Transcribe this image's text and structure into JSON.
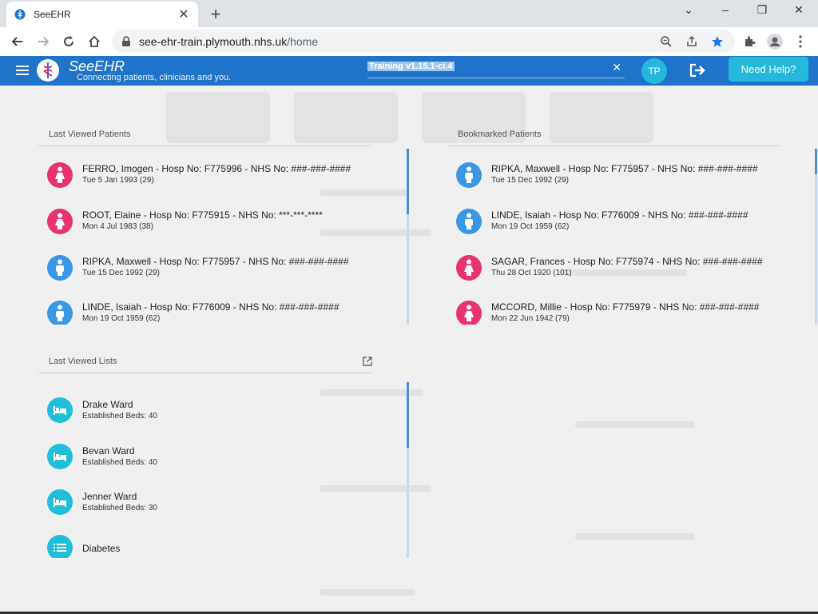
{
  "browser": {
    "tab_title": "SeeEHR",
    "url_host": "see-ehr-train.plymouth.nhs.uk",
    "url_path": "/home"
  },
  "header": {
    "brand": "SeeEHR",
    "tagline": "Connecting patients, clinicians and you.",
    "environment": "Training v1.15.1-ci.4",
    "user_initials": "TP",
    "help_label": "Need Help?"
  },
  "colors": {
    "brand_blue": "#1f73c8",
    "female": "#e8346e",
    "male": "#3a97e6",
    "list": "#1fbfd9"
  },
  "last_viewed_patients": {
    "title": "Last Viewed Patients",
    "items": [
      {
        "name": "FERRO, Imogen - Hosp No: F775996 - NHS No: ###-###-####",
        "sub": "Tue 5 Jan 1993 (29)",
        "sex": "female"
      },
      {
        "name": "ROOT, Elaine - Hosp No: F775915 - NHS No: ***-***-****",
        "sub": "Mon 4 Jul 1983 (38)",
        "sex": "female"
      },
      {
        "name": "RIPKA, Maxwell - Hosp No: F775957 - NHS No: ###-###-####",
        "sub": "Tue 15 Dec 1992 (29)",
        "sex": "male"
      },
      {
        "name": "LINDE, Isaiah - Hosp No: F776009 - NHS No: ###-###-####",
        "sub": "Mon 19 Oct 1959 (62)",
        "sex": "male"
      }
    ]
  },
  "bookmarked_patients": {
    "title": "Bookmarked Patients",
    "items": [
      {
        "name": "RIPKA, Maxwell - Hosp No: F775957 - NHS No: ###-###-####",
        "sub": "Tue 15 Dec 1992 (29)",
        "sex": "male"
      },
      {
        "name": "LINDE, Isaiah - Hosp No: F776009 - NHS No: ###-###-####",
        "sub": "Mon 19 Oct 1959 (62)",
        "sex": "male"
      },
      {
        "name": "SAGAR, Frances - Hosp No: F775974 - NHS No: ###-###-####",
        "sub": "Thu 28 Oct 1920 (101)",
        "sex": "female"
      },
      {
        "name": "MCCORD, Millie - Hosp No: F775979 - NHS No: ###-###-####",
        "sub": "Mon 22 Jun 1942 (79)",
        "sex": "female"
      }
    ]
  },
  "last_viewed_lists": {
    "title": "Last Viewed Lists",
    "items": [
      {
        "name": "Drake Ward",
        "sub": "Established Beds: 40",
        "icon": "bed-icon"
      },
      {
        "name": "Bevan Ward",
        "sub": "Established Beds: 40",
        "icon": "bed-icon"
      },
      {
        "name": "Jenner Ward",
        "sub": "Established Beds: 30",
        "icon": "bed-icon"
      },
      {
        "name": "Diabetes",
        "sub": "",
        "icon": "list-icon"
      }
    ]
  }
}
